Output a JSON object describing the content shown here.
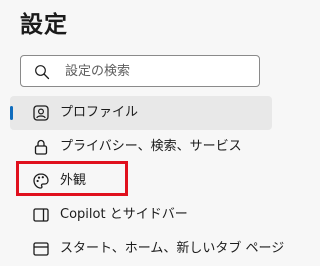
{
  "header": {
    "title": "設定"
  },
  "search": {
    "placeholder": "設定の検索",
    "value": ""
  },
  "sidebar": {
    "items": [
      {
        "label": "プロファイル",
        "icon": "profile-icon",
        "active": true
      },
      {
        "label": "プライバシー、検索、サービス",
        "icon": "lock-icon",
        "active": false
      },
      {
        "label": "外観",
        "icon": "palette-icon",
        "active": false
      },
      {
        "label": "Copilot とサイドバー",
        "icon": "sidebar-icon",
        "active": false
      },
      {
        "label": "スタート、ホーム、新しいタブ ページ",
        "icon": "home-icon",
        "active": false
      }
    ]
  },
  "colors": {
    "accent": "#0f6cbd",
    "highlight_border": "#e0101e",
    "active_background": "#e8e8e8",
    "page_background": "#f7f7f7"
  }
}
